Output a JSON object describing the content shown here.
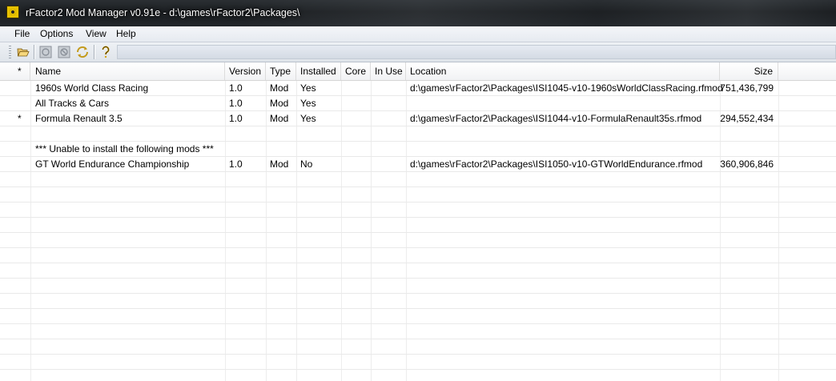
{
  "window": {
    "title": "rFactor2 Mod Manager v0.91e - d:\\games\\rFactor2\\Packages\\"
  },
  "menu": {
    "items": [
      "File",
      "Options",
      "View",
      "Help"
    ]
  },
  "toolbar": {
    "buttons": [
      "open-folder-icon",
      "install-icon",
      "uninstall-icon",
      "refresh-icon",
      "help-icon"
    ]
  },
  "table": {
    "headers": {
      "star": "*",
      "name": "Name",
      "version": "Version",
      "type": "Type",
      "installed": "Installed",
      "core": "Core",
      "inuse": "In Use",
      "location": "Location",
      "size": "Size"
    },
    "rows": [
      {
        "star": "",
        "name": "1960s World Class Racing",
        "version": "1.0",
        "type": "Mod",
        "installed": "Yes",
        "core": "",
        "inuse": "",
        "location": "d:\\games\\rFactor2\\Packages\\ISI1045-v10-1960sWorldClassRacing.rfmod",
        "size": "751,436,799"
      },
      {
        "star": "",
        "name": "All Tracks & Cars",
        "version": "1.0",
        "type": "Mod",
        "installed": "Yes",
        "core": "",
        "inuse": "",
        "location": "",
        "size": ""
      },
      {
        "star": "*",
        "name": "Formula Renault 3.5",
        "version": "1.0",
        "type": "Mod",
        "installed": "Yes",
        "core": "",
        "inuse": "",
        "location": "d:\\games\\rFactor2\\Packages\\ISI1044-v10-FormulaRenault35s.rfmod",
        "size": "294,552,434"
      },
      {
        "star": "",
        "name": "",
        "version": "",
        "type": "",
        "installed": "",
        "core": "",
        "inuse": "",
        "location": "",
        "size": ""
      },
      {
        "star": "",
        "name": "*** Unable to install the following mods ***",
        "version": "",
        "type": "",
        "installed": "",
        "core": "",
        "inuse": "",
        "location": "",
        "size": ""
      },
      {
        "star": "",
        "name": "GT World Endurance Championship",
        "version": "1.0",
        "type": "Mod",
        "installed": "No",
        "core": "",
        "inuse": "",
        "location": "d:\\games\\rFactor2\\Packages\\ISI1050-v10-GTWorldEndurance.rfmod",
        "size": "360,906,846"
      }
    ]
  }
}
